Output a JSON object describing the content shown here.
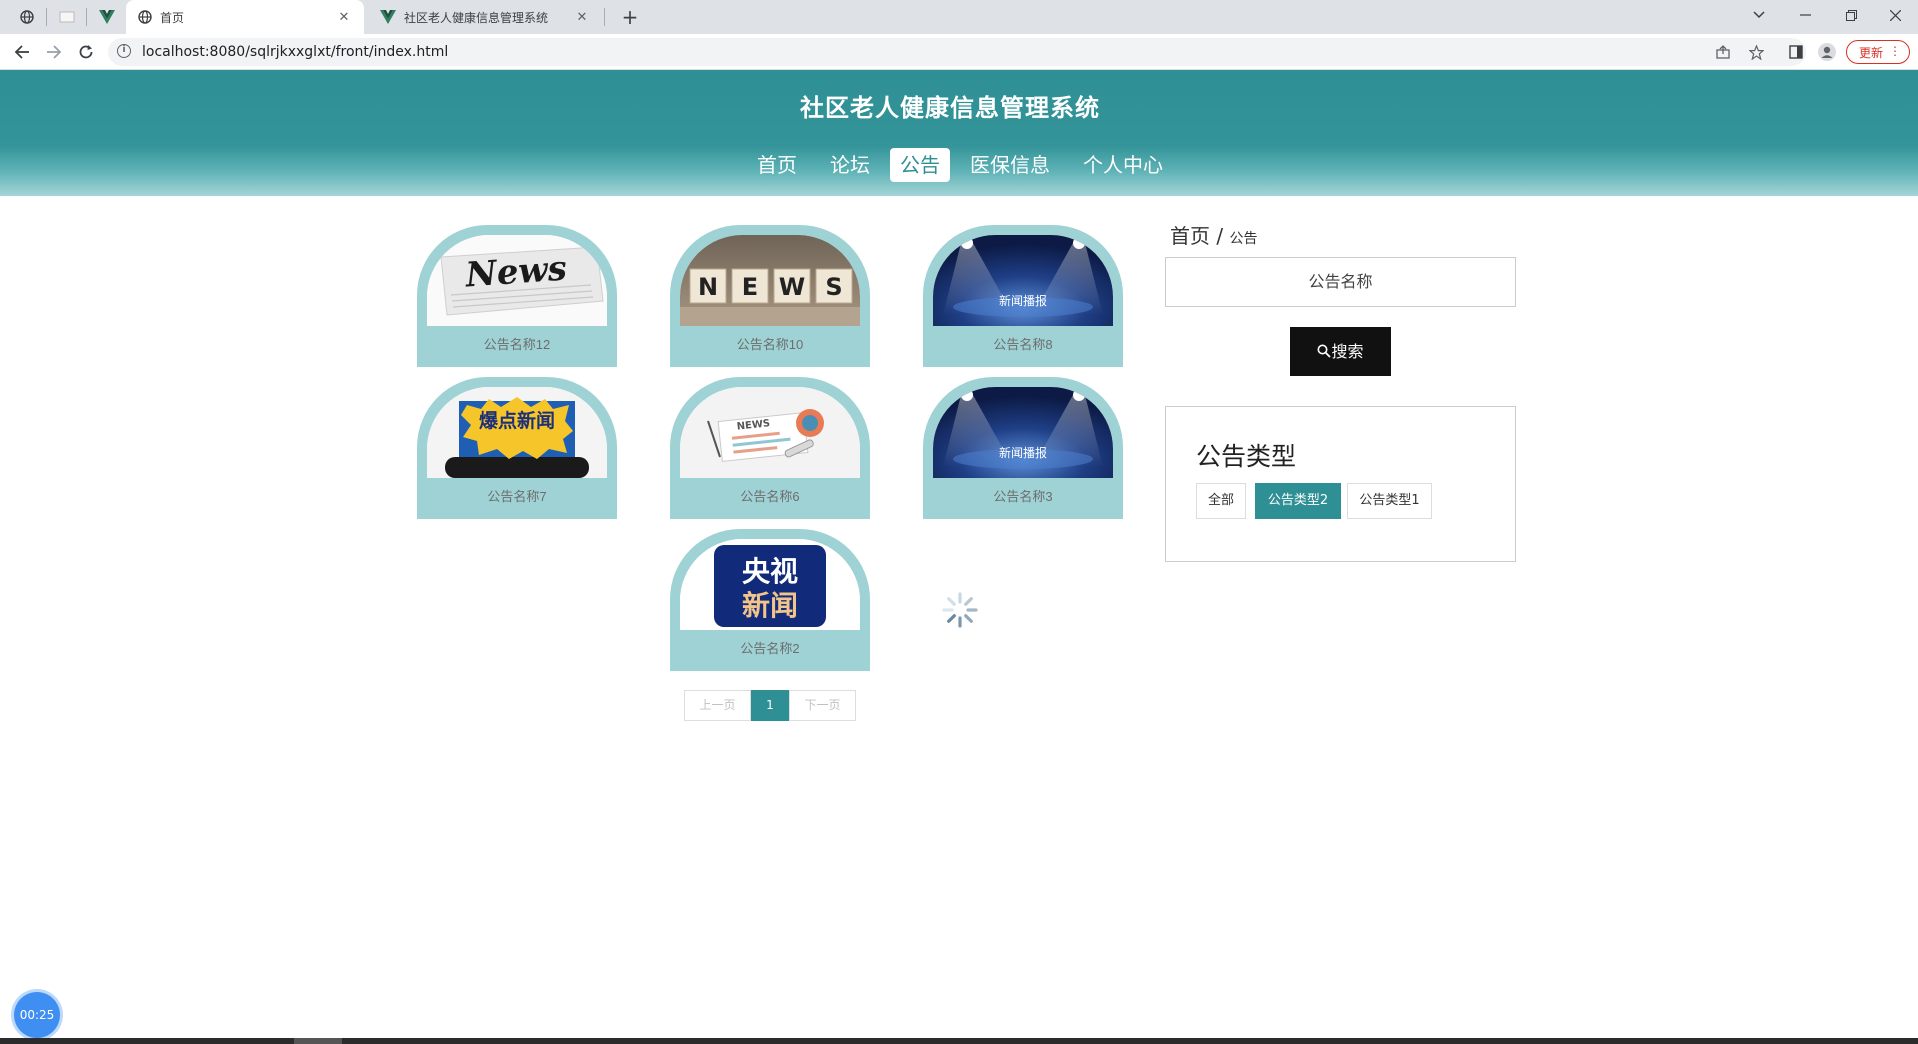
{
  "browser": {
    "tabs": [
      {
        "title": "首页",
        "active": true
      },
      {
        "title": "社区老人健康信息管理系统",
        "active": false
      }
    ],
    "url": "localhost:8080/sqlrjkxxglxt/front/index.html",
    "update_label": "更新"
  },
  "site": {
    "title": "社区老人健康信息管理系统",
    "nav": [
      "首页",
      "论坛",
      "公告",
      "医保信息",
      "个人中心"
    ],
    "active_nav": "公告"
  },
  "cards": [
    {
      "caption": "公告名称12",
      "image": "news-newspaper"
    },
    {
      "caption": "公告名称10",
      "image": "news-blocks"
    },
    {
      "caption": "公告名称8",
      "image": "news-spotlight",
      "image_text": "新闻播报"
    },
    {
      "caption": "公告名称7",
      "image": "news-burst",
      "image_text": "爆点新闻"
    },
    {
      "caption": "公告名称6",
      "image": "news-illustration"
    },
    {
      "caption": "公告名称3",
      "image": "news-spotlight",
      "image_text": "新闻播报"
    },
    {
      "caption": "公告名称2",
      "image": "cctv-news",
      "image_text_line1": "央视",
      "image_text_line2": "新闻"
    }
  ],
  "news_words": {
    "blocks": [
      "N",
      "E",
      "W",
      "S"
    ],
    "newspaper": "News",
    "illus": "NEWS"
  },
  "pagination": {
    "prev": "上一页",
    "current": "1",
    "next": "下一页"
  },
  "sidebar": {
    "breadcrumb_home": "首页",
    "breadcrumb_sep": "/",
    "breadcrumb_current": "公告",
    "search_placeholder": "公告名称",
    "search_button": "搜索",
    "type_title": "公告类型",
    "types": [
      "全部",
      "公告类型2",
      "公告类型1"
    ],
    "selected_type": "公告类型2"
  },
  "timer": "00:25",
  "colors": {
    "brand": "#2e8f94",
    "card": "#9ed2d5"
  }
}
